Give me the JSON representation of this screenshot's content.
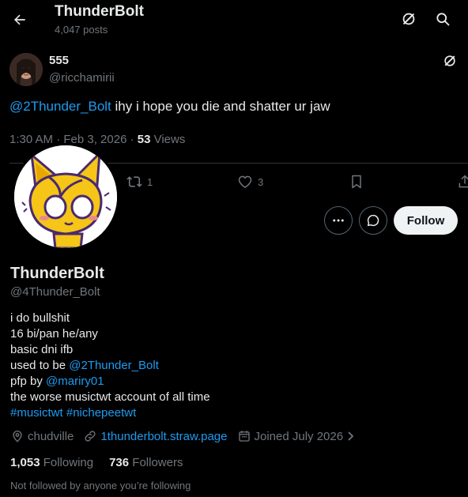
{
  "header": {
    "name": "ThunderBolt",
    "posts": "4,047 posts"
  },
  "tweet": {
    "name": "555",
    "handle": "@ricchamirii",
    "mention": "@2Thunder_Bolt",
    "text": " ihy i hope you die and shatter ur jaw",
    "time": "1:30 AM · Feb 3, 2026 · ",
    "views_count": "53",
    "views_label": " Views",
    "retweets": "1",
    "likes": "3"
  },
  "profile": {
    "name": "ThunderBolt",
    "handle": "@4Thunder_Bolt",
    "follow_label": "Follow",
    "bio": {
      "line1": "i do bullshit",
      "line2": "16 bi/pan he/any",
      "line3": "basic dni ifb",
      "line4_prefix": "used to be ",
      "line4_link": "@2Thunder_Bolt",
      "line5_prefix": "pfp by ",
      "line5_link": "@mariry01",
      "line6": "the worse musictwt account of all time",
      "hashtag1": "#musictwt",
      "hashtag2": "#nichepeetwt"
    },
    "location": "chudville",
    "website": "1thunderbolt.straw.page",
    "joined": "Joined July 2026",
    "following_count": "1,053",
    "following_label": "Following",
    "followers_count": "736",
    "followers_label": "Followers",
    "not_followed": "Not followed by anyone you’re following"
  },
  "colors": {
    "accent": "#1d9bf0",
    "secondary_text": "#71767b",
    "primary_text": "#e7e9ea",
    "background": "#000000"
  },
  "icons": [
    "back-arrow-icon",
    "grok-icon",
    "search-icon",
    "more-icon",
    "message-icon",
    "reply-icon",
    "retweet-icon",
    "like-icon",
    "bookmark-icon",
    "share-icon",
    "location-icon",
    "link-icon",
    "calendar-icon",
    "chevron-right-icon"
  ]
}
